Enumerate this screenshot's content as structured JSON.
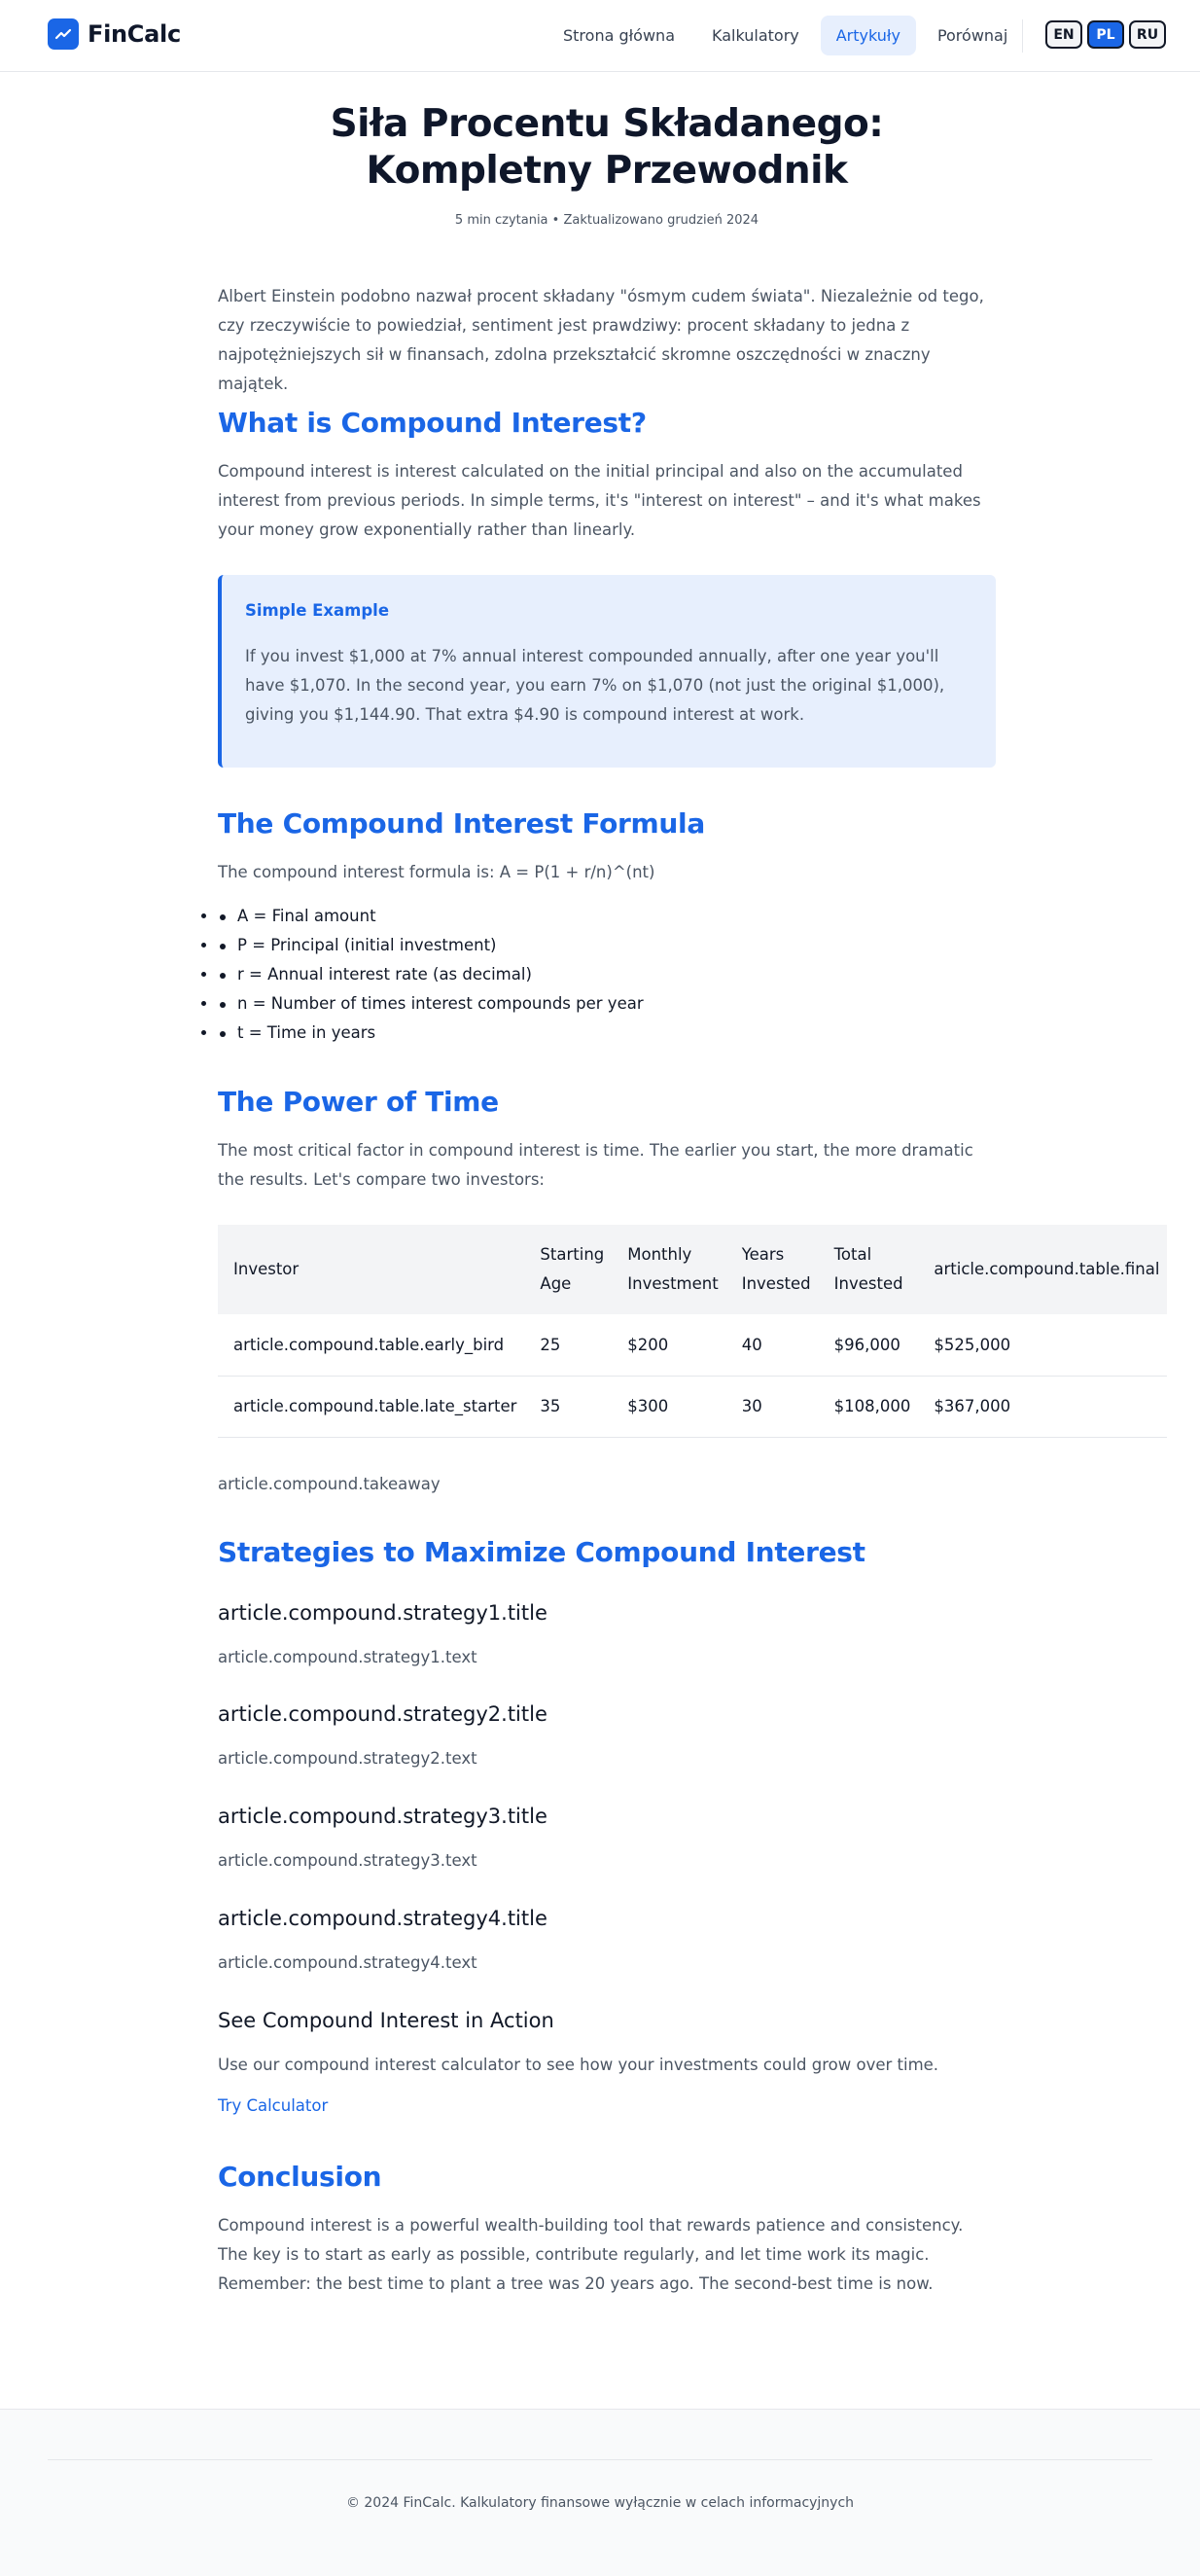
{
  "header": {
    "logo_text": "FinCalc",
    "nav": [
      "Strona główna",
      "Kalkulatory",
      "Artykuły",
      "Porównaj"
    ],
    "active_nav": "Artykuły",
    "languages": [
      "EN",
      "PL",
      "RU"
    ],
    "active_language": "PL"
  },
  "article": {
    "title": "Siła Procentu Składanego: Kompletny Przewodnik",
    "meta": "5 min czytania • Zaktualizowano grudzień 2024",
    "intro": "Albert Einstein podobno nazwał procent składany \"ósmym cudem świata\". Niezależnie od tego, czy rzeczywiście to powiedział, sentiment jest prawdziwy: procent składany to jedna z najpotężniejszych sił w finansach, zdolna przekształcić skromne oszczędności w znaczny majątek.",
    "what_title": "What is Compound Interest?",
    "what_text": "Compound interest is interest calculated on the initial principal and also on the accumulated interest from previous periods. In simple terms, it's \"interest on interest\" – and it's what makes your money grow exponentially rather than linearly.",
    "example_title": "Simple Example",
    "example_text": "If you invest $1,000 at 7% annual interest compounded annually, after one year you'll have $1,070. In the second year, you earn 7% on $1,070 (not just the original $1,000), giving you $1,144.90. That extra $4.90 is compound interest at work.",
    "formula_title": "The Compound Interest Formula",
    "formula_text": "The compound interest formula is: A = P(1 + r/n)^(nt)",
    "formula_items": [
      "A = Final amount",
      "P = Principal (initial investment)",
      "r = Annual interest rate (as decimal)",
      "n = Number of times interest compounds per year",
      "t = Time in years"
    ],
    "time_title": "The Power of Time",
    "time_text": "The most critical factor in compound interest is time. The earlier you start, the more dramatic the results. Let's compare two investors:",
    "table": {
      "headers": [
        "Investor",
        "Starting Age",
        "Monthly Investment",
        "Years Invested",
        "Total Invested",
        "article.compound.table.final"
      ],
      "rows": [
        [
          "article.compound.table.early_bird",
          "25",
          "$200",
          "40",
          "$96,000",
          "$525,000"
        ],
        [
          "article.compound.table.late_starter",
          "35",
          "$300",
          "30",
          "$108,000",
          "$367,000"
        ]
      ]
    },
    "takeaway": "article.compound.takeaway",
    "strategies_title": "Strategies to Maximize Compound Interest",
    "strategies": [
      {
        "title": "article.compound.strategy1.title",
        "text": "article.compound.strategy1.text"
      },
      {
        "title": "article.compound.strategy2.title",
        "text": "article.compound.strategy2.text"
      },
      {
        "title": "article.compound.strategy3.title",
        "text": "article.compound.strategy3.text"
      },
      {
        "title": "article.compound.strategy4.title",
        "text": "article.compound.strategy4.text"
      }
    ],
    "action_title": "See Compound Interest in Action",
    "action_text": "Use our compound interest calculator to see how your investments could grow over time.",
    "action_link": "Try Calculator",
    "conclusion_title": "Conclusion",
    "conclusion_text": "Compound interest is a powerful wealth-building tool that rewards patience and consistency. The key is to start as early as possible, contribute regularly, and let time work its magic. Remember: the best time to plant a tree was 20 years ago. The second-best time is now."
  },
  "footer": {
    "text": "© 2024 FinCalc. Kalkulatory finansowe wyłącznie w celach informacyjnych"
  },
  "colors": {
    "accent": "#1a66e6",
    "callout_bg": "#e7effd"
  }
}
